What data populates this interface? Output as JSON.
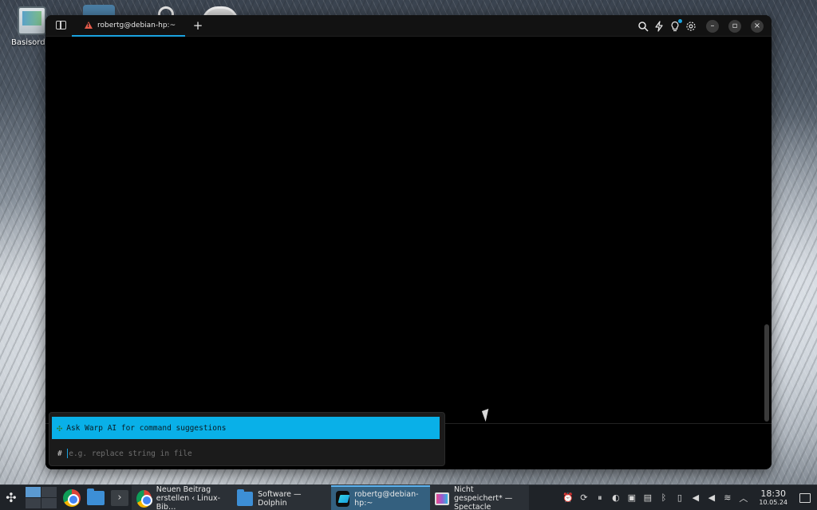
{
  "desktop": {
    "icons": [
      {
        "label": "Basisordner"
      }
    ]
  },
  "window": {
    "tab_title": "robertg@debian-hp:~",
    "new_tab_label": "+",
    "actions": {
      "minimize": "–",
      "maximize": "▫",
      "close": "×"
    }
  },
  "ai_panel": {
    "suggestion": "Ask Warp AI for command suggestions",
    "prompt_symbol": "#",
    "input_placeholder": "e.g. replace string in file",
    "input_value": ""
  },
  "taskbar": {
    "tasks": [
      {
        "label_line1": "Neuen Beitrag",
        "label_line2": "erstellen ‹ Linux-Bib…"
      },
      {
        "label_line1": "Software — Dolphin",
        "label_line2": ""
      },
      {
        "label_line1": "robertg@debian-hp:~",
        "label_line2": ""
      },
      {
        "label_line1": "Nicht gespeichert* —",
        "label_line2": "Spectacle"
      }
    ],
    "clock": {
      "time": "18:30",
      "date": "10.05.24"
    }
  },
  "colors": {
    "accent": "#09b0e8",
    "terminal_bg": "#000000",
    "taskbar_bg": "#1f2328",
    "active_task": "#34607f"
  }
}
